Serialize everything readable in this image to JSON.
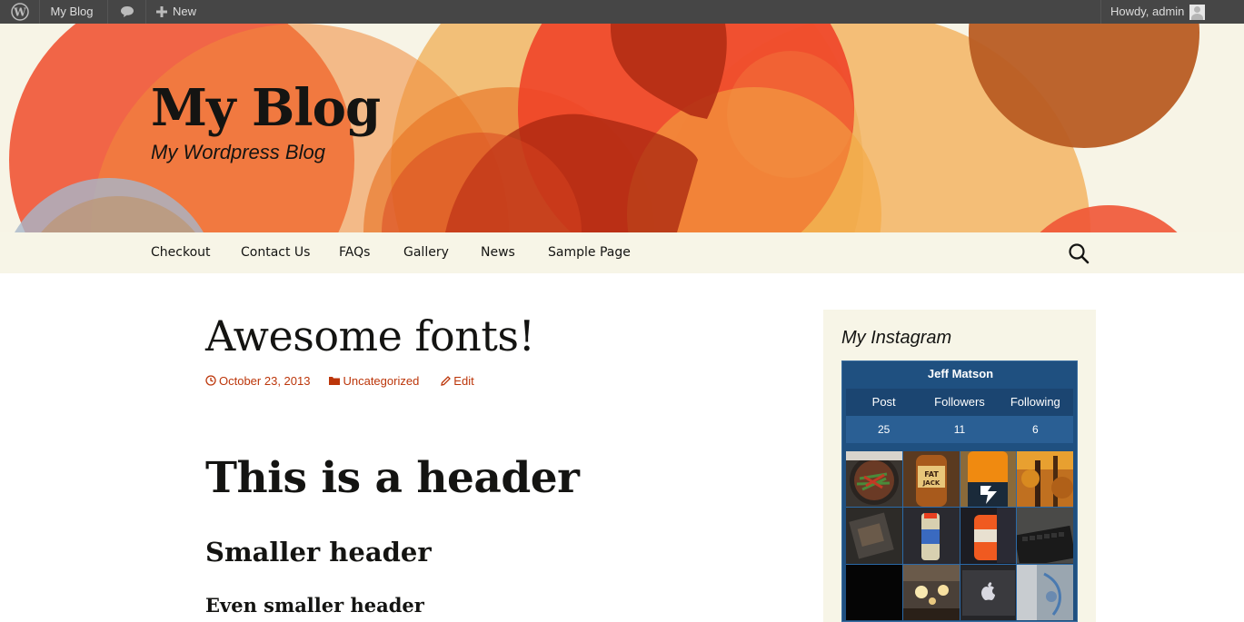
{
  "admin_bar": {
    "site_name": "My Blog",
    "new_label": "New",
    "account_label": "Howdy, admin",
    "icons": {
      "wp": "wordpress-logo-icon",
      "comments": "comment-bubble-icon",
      "new": "plus-icon",
      "avatar": "avatar"
    }
  },
  "header": {
    "title": "My Blog",
    "tagline": "My Wordpress Blog"
  },
  "nav": {
    "items": [
      {
        "label": "Checkout"
      },
      {
        "label": "Contact Us"
      },
      {
        "label": "FAQs"
      },
      {
        "label": "Gallery"
      },
      {
        "label": "News"
      },
      {
        "label": "Sample Page"
      }
    ],
    "search_icon": "search-icon"
  },
  "post": {
    "title": "Awesome fonts!",
    "date": "October 23, 2013",
    "category": "Uncategorized",
    "edit_label": "Edit",
    "headings": {
      "h1": "This is a header",
      "h2": "Smaller header",
      "h3": "Even smaller header"
    }
  },
  "sidebar": {
    "widget_title": "My Instagram",
    "instagram": {
      "name": "Jeff Matson",
      "stats_labels": [
        "Post",
        "Followers",
        "Following"
      ],
      "stats_values": [
        "25",
        "11",
        "6"
      ],
      "photos_count_shown": 12
    }
  },
  "colors": {
    "admin_bar_bg": "#464646",
    "header_bg": "#f7f4e6",
    "nav_bg": "#f7f5e7",
    "accent": "#bc360a",
    "instagram_blue": "#1f5080"
  }
}
